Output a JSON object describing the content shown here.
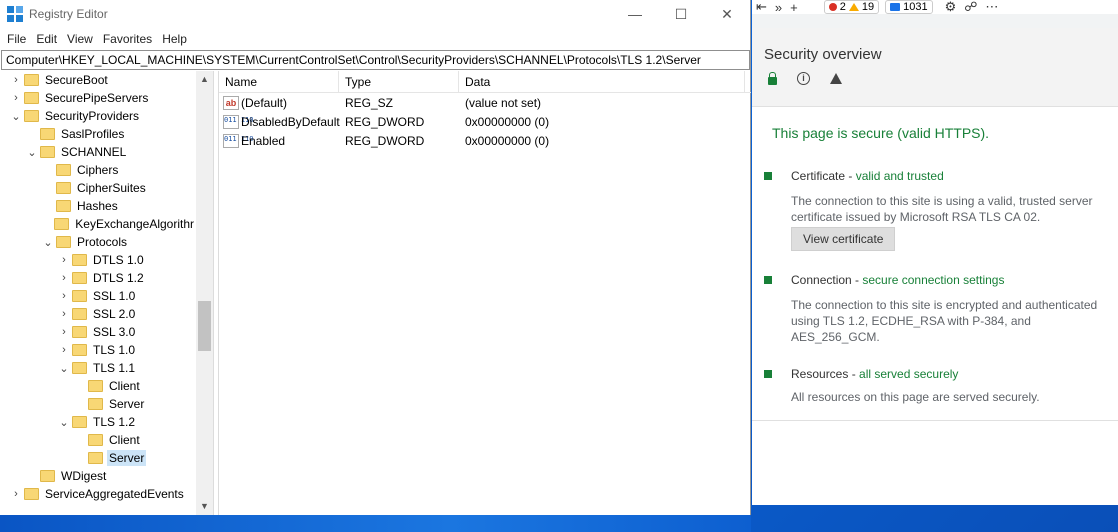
{
  "regedit": {
    "title": "Registry Editor",
    "controls": {
      "minimize": "—",
      "maximize": "☐",
      "close": "✕"
    },
    "menu": [
      "File",
      "Edit",
      "View",
      "Favorites",
      "Help"
    ],
    "address": "Computer\\HKEY_LOCAL_MACHINE\\SYSTEM\\CurrentControlSet\\Control\\SecurityProviders\\SCHANNEL\\Protocols\\TLS 1.2\\Server",
    "tree": [
      {
        "label": "SecureBoot",
        "chevron": "›"
      },
      {
        "label": "SecurePipeServers",
        "chevron": "›"
      },
      {
        "label": "SecurityProviders",
        "chevron": "⌄"
      },
      {
        "label": "SaslProfiles",
        "chevron": ""
      },
      {
        "label": "SCHANNEL",
        "chevron": "⌄"
      },
      {
        "label": "Ciphers",
        "chevron": ""
      },
      {
        "label": "CipherSuites",
        "chevron": ""
      },
      {
        "label": "Hashes",
        "chevron": ""
      },
      {
        "label": "KeyExchangeAlgorithr",
        "chevron": ""
      },
      {
        "label": "Protocols",
        "chevron": "⌄"
      },
      {
        "label": "DTLS 1.0",
        "chevron": "›"
      },
      {
        "label": "DTLS 1.2",
        "chevron": "›"
      },
      {
        "label": "SSL 1.0",
        "chevron": "›"
      },
      {
        "label": "SSL 2.0",
        "chevron": "›"
      },
      {
        "label": "SSL 3.0",
        "chevron": "›"
      },
      {
        "label": "TLS 1.0",
        "chevron": "›"
      },
      {
        "label": "TLS 1.1",
        "chevron": "⌄"
      },
      {
        "label": "Client",
        "chevron": ""
      },
      {
        "label": "Server",
        "chevron": ""
      },
      {
        "label": "TLS 1.2",
        "chevron": "⌄"
      },
      {
        "label": "Client",
        "chevron": ""
      },
      {
        "label": "Server",
        "chevron": ""
      },
      {
        "label": "WDigest",
        "chevron": ""
      },
      {
        "label": "ServiceAggregatedEvents",
        "chevron": "›"
      }
    ],
    "columns": {
      "name": "Name",
      "type": "Type",
      "data": "Data"
    },
    "values": [
      {
        "icon": "ab",
        "name": "(Default)",
        "type": "REG_SZ",
        "data": "(value not set)"
      },
      {
        "icon": "bin",
        "name": "DisabledByDefault",
        "type": "REG_DWORD",
        "data": "0x00000000 (0)"
      },
      {
        "icon": "bin",
        "name": "Enabled",
        "type": "REG_DWORD",
        "data": "0x00000000 (0)"
      }
    ]
  },
  "devtools": {
    "toolbar": {
      "more": "»",
      "add": "+",
      "errors": "2",
      "warnings": "19",
      "messages": "1031"
    },
    "security": {
      "title": "Security overview",
      "summary": "This page is secure (valid HTTPS).",
      "certificate": {
        "label": "Certificate - ",
        "status": "valid and trusted",
        "desc": "The connection to this site is using a valid, trusted server certificate issued by Microsoft RSA TLS CA 02.",
        "button": "View certificate"
      },
      "connection": {
        "label": "Connection - ",
        "status": "secure connection settings",
        "desc": "The connection to this site is encrypted and authenticated using TLS 1.2, ECDHE_RSA with P-384, and AES_256_GCM."
      },
      "resources": {
        "label": "Resources - ",
        "status": "all served securely",
        "desc": "All resources on this page are served securely."
      }
    }
  }
}
